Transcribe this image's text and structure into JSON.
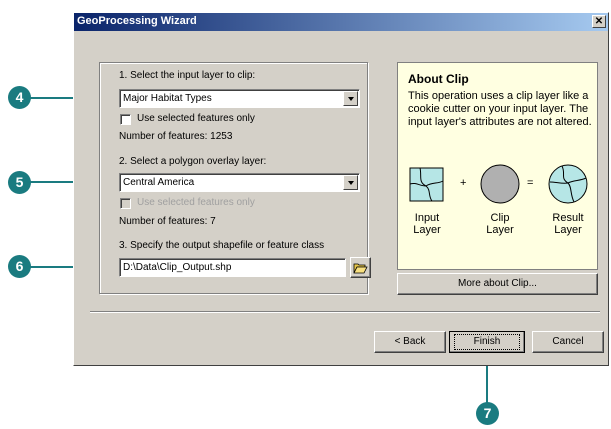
{
  "window": {
    "title": "GeoProcessing Wizard",
    "close_glyph": "✕"
  },
  "step1": {
    "label": "1. Select the input layer to clip:",
    "value": "Major Habitat Types",
    "checkbox_label": "Use selected features only",
    "count": "Number of features: 1253"
  },
  "step2": {
    "label": "2. Select a polygon overlay layer:",
    "value": "Central America",
    "checkbox_label": "Use selected features only",
    "count": "Number of features: 7"
  },
  "step3": {
    "label": "3. Specify the output shapefile or feature class",
    "value": "D:\\Data\\Clip_Output.shp"
  },
  "about": {
    "heading": "About Clip",
    "description": "This operation uses a clip layer like a cookie cutter on your input layer.  The input layer's attributes are not altered.",
    "plus": "+",
    "equals": "=",
    "input_caption": "Input\nLayer",
    "clip_caption": "Clip\nLayer",
    "result_caption": "Result\nLayer",
    "more_button": "More about Clip..."
  },
  "buttons": {
    "back": "< Back",
    "finish": "Finish",
    "cancel": "Cancel"
  },
  "callouts": [
    "4",
    "5",
    "6",
    "7"
  ],
  "colors": {
    "callout": "#1a7b80",
    "info_panel": "#ffffe1",
    "titlebar": "#0a246a"
  },
  "icons": {
    "browse": "open-folder-icon"
  }
}
